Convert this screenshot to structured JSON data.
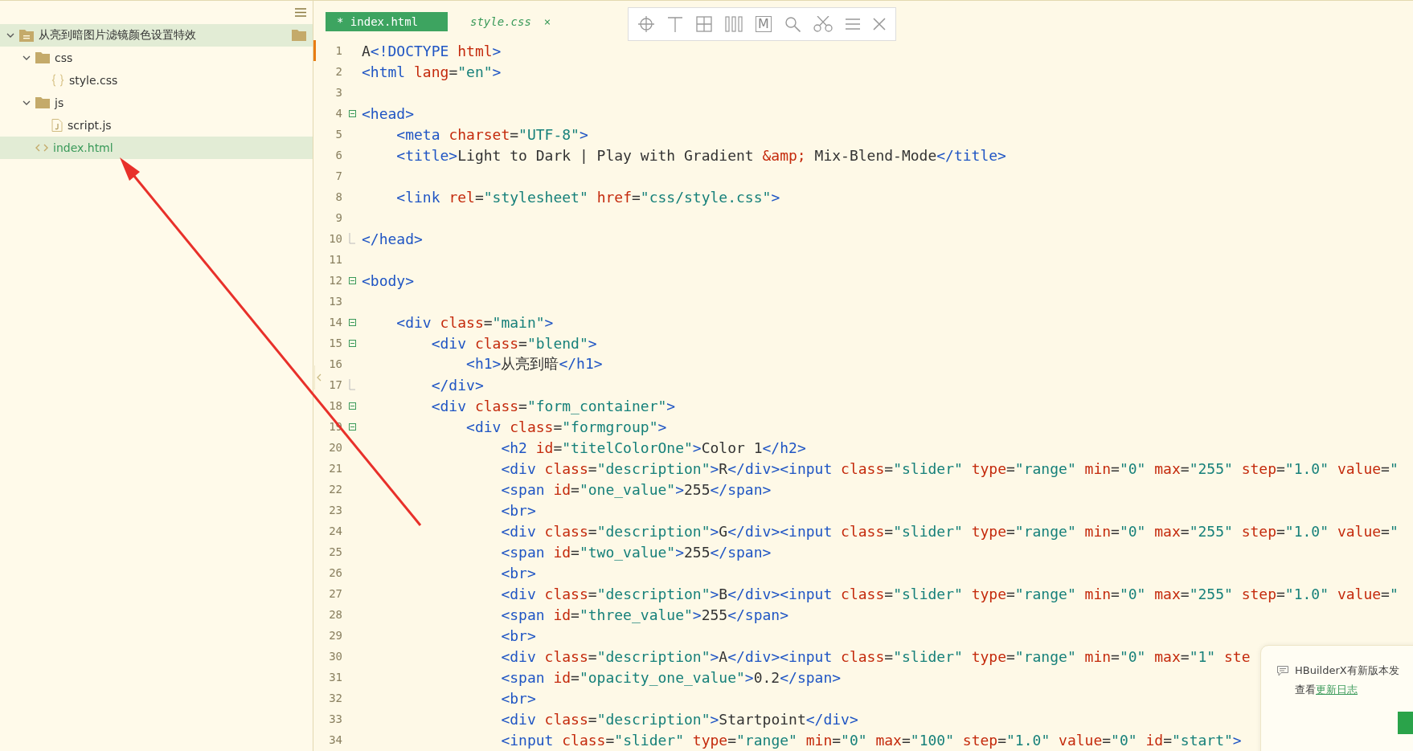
{
  "sidebar": {
    "tree": [
      {
        "name": "从亮到暗图片滤镜颜色设置特效",
        "kind": "project",
        "expanded": true,
        "selected": false,
        "children": [
          {
            "name": "css",
            "kind": "folder",
            "expanded": true,
            "selected": false,
            "children": [
              {
                "name": "style.css",
                "kind": "css",
                "selected": false
              }
            ]
          },
          {
            "name": "js",
            "kind": "folder",
            "expanded": true,
            "selected": false,
            "children": [
              {
                "name": "script.js",
                "kind": "js",
                "selected": false
              }
            ]
          },
          {
            "name": "index.html",
            "kind": "html",
            "selected": true
          }
        ]
      }
    ]
  },
  "tabs": [
    {
      "label": "* index.html",
      "selected": true
    },
    {
      "label": "style.css",
      "selected": false,
      "close": "×"
    }
  ],
  "toolbar": [
    {
      "kind": "target"
    },
    {
      "kind": "tee"
    },
    {
      "kind": "grid"
    },
    {
      "kind": "columns"
    },
    {
      "kind": "letter",
      "label": "M"
    },
    {
      "kind": "search"
    },
    {
      "kind": "scissors"
    },
    {
      "kind": "menu"
    },
    {
      "kind": "close"
    }
  ],
  "editor": {
    "lines": [
      {
        "number": "1",
        "kind": "plain",
        "tokens": [
          {
            "kind": "text",
            "text": "A"
          },
          {
            "kind": "tag",
            "text": "<!DOCTYPE"
          },
          {
            "kind": "attr",
            "text": " html"
          },
          {
            "kind": "tag",
            "text": ">"
          }
        ]
      },
      {
        "number": "2",
        "kind": "plain",
        "tokens": [
          {
            "kind": "tag",
            "text": "<html"
          },
          {
            "kind": "attr",
            "text": " lang"
          },
          {
            "kind": "text",
            "text": "="
          },
          {
            "kind": "str",
            "text": "\"en\""
          },
          {
            "kind": "tag",
            "text": ">"
          }
        ]
      },
      {
        "number": "3",
        "kind": "plain"
      },
      {
        "number": "4",
        "kind": "fold-start",
        "tokens": [
          {
            "kind": "tag",
            "text": "<head>"
          }
        ]
      },
      {
        "number": "5",
        "kind": "plain",
        "tokens": [
          {
            "kind": "tag",
            "text": "    <meta"
          },
          {
            "kind": "attr",
            "text": " charset"
          },
          {
            "kind": "text",
            "text": "="
          },
          {
            "kind": "str",
            "text": "\"UTF-8\""
          },
          {
            "kind": "tag",
            "text": ">"
          }
        ]
      },
      {
        "number": "6",
        "kind": "plain",
        "tokens": [
          {
            "kind": "tag",
            "text": "    <title>"
          },
          {
            "kind": "text",
            "text": "Light to Dark | Play with Gradient "
          },
          {
            "kind": "attr",
            "text": "&amp;"
          },
          {
            "kind": "text",
            "text": " Mix-Blend-Mode"
          },
          {
            "kind": "tag",
            "text": "</title>"
          }
        ]
      },
      {
        "number": "7",
        "kind": "plain"
      },
      {
        "number": "8",
        "kind": "plain",
        "tokens": [
          {
            "kind": "tag",
            "text": "    <link"
          },
          {
            "kind": "attr",
            "text": " rel"
          },
          {
            "kind": "text",
            "text": "="
          },
          {
            "kind": "str",
            "text": "\"stylesheet\""
          },
          {
            "kind": "attr",
            "text": " href"
          },
          {
            "kind": "text",
            "text": "="
          },
          {
            "kind": "str",
            "text": "\"css/style.css\""
          },
          {
            "kind": "tag",
            "text": ">"
          }
        ]
      },
      {
        "number": "9",
        "kind": "plain"
      },
      {
        "number": "10",
        "kind": "fold-end",
        "tokens": [
          {
            "kind": "tag",
            "text": "</head>"
          }
        ]
      },
      {
        "number": "11",
        "kind": "plain"
      },
      {
        "number": "12",
        "kind": "fold-start",
        "tokens": [
          {
            "kind": "tag",
            "text": "<body>"
          }
        ]
      },
      {
        "number": "13",
        "kind": "plain"
      },
      {
        "number": "14",
        "kind": "fold-start",
        "tokens": [
          {
            "kind": "tag",
            "text": "    <div"
          },
          {
            "kind": "attr",
            "text": " class"
          },
          {
            "kind": "text",
            "text": "="
          },
          {
            "kind": "str",
            "text": "\"main\""
          },
          {
            "kind": "tag",
            "text": ">"
          }
        ]
      },
      {
        "number": "15",
        "kind": "fold-start",
        "tokens": [
          {
            "kind": "tag",
            "text": "        <div"
          },
          {
            "kind": "attr",
            "text": " class"
          },
          {
            "kind": "text",
            "text": "="
          },
          {
            "kind": "str",
            "text": "\"blend\""
          },
          {
            "kind": "tag",
            "text": ">"
          }
        ]
      },
      {
        "number": "16",
        "kind": "plain",
        "tokens": [
          {
            "kind": "tag",
            "text": "            <h1>"
          },
          {
            "kind": "text",
            "text": "从亮到暗"
          },
          {
            "kind": "tag",
            "text": "</h1>"
          }
        ]
      },
      {
        "number": "17",
        "kind": "fold-end",
        "tokens": [
          {
            "kind": "tag",
            "text": "        </div>"
          }
        ]
      },
      {
        "number": "18",
        "kind": "fold-start",
        "tokens": [
          {
            "kind": "tag",
            "text": "        <div"
          },
          {
            "kind": "attr",
            "text": " class"
          },
          {
            "kind": "text",
            "text": "="
          },
          {
            "kind": "str",
            "text": "\"form_container\""
          },
          {
            "kind": "tag",
            "text": ">"
          }
        ]
      },
      {
        "number": "19",
        "kind": "fold-start",
        "tokens": [
          {
            "kind": "tag",
            "text": "            <div"
          },
          {
            "kind": "attr",
            "text": " class"
          },
          {
            "kind": "text",
            "text": "="
          },
          {
            "kind": "str",
            "text": "\"formgroup\""
          },
          {
            "kind": "tag",
            "text": ">"
          }
        ]
      },
      {
        "number": "20",
        "kind": "plain",
        "tokens": [
          {
            "kind": "tag",
            "text": "                <h2"
          },
          {
            "kind": "attr",
            "text": " id"
          },
          {
            "kind": "text",
            "text": "="
          },
          {
            "kind": "str",
            "text": "\"titelColorOne\""
          },
          {
            "kind": "tag",
            "text": ">"
          },
          {
            "kind": "text",
            "text": "Color 1"
          },
          {
            "kind": "tag",
            "text": "</h2>"
          }
        ]
      },
      {
        "number": "21",
        "kind": "plain",
        "tokens": [
          {
            "kind": "tag",
            "text": "                <div"
          },
          {
            "kind": "attr",
            "text": " class"
          },
          {
            "kind": "text",
            "text": "="
          },
          {
            "kind": "str",
            "text": "\"description\""
          },
          {
            "kind": "tag",
            "text": ">"
          },
          {
            "kind": "text",
            "text": "R"
          },
          {
            "kind": "tag",
            "text": "</div><input"
          },
          {
            "kind": "attr",
            "text": " class"
          },
          {
            "kind": "text",
            "text": "="
          },
          {
            "kind": "str",
            "text": "\"slider\""
          },
          {
            "kind": "attr",
            "text": " type"
          },
          {
            "kind": "text",
            "text": "="
          },
          {
            "kind": "str",
            "text": "\"range\""
          },
          {
            "kind": "attr",
            "text": " min"
          },
          {
            "kind": "text",
            "text": "="
          },
          {
            "kind": "str",
            "text": "\"0\""
          },
          {
            "kind": "attr",
            "text": " max"
          },
          {
            "kind": "text",
            "text": "="
          },
          {
            "kind": "str",
            "text": "\"255\""
          },
          {
            "kind": "attr",
            "text": " step"
          },
          {
            "kind": "text",
            "text": "="
          },
          {
            "kind": "str",
            "text": "\"1.0\""
          },
          {
            "kind": "attr",
            "text": " value"
          },
          {
            "kind": "text",
            "text": "="
          },
          {
            "kind": "str",
            "text": "\""
          }
        ]
      },
      {
        "number": "22",
        "kind": "plain",
        "tokens": [
          {
            "kind": "tag",
            "text": "                <span"
          },
          {
            "kind": "attr",
            "text": " id"
          },
          {
            "kind": "text",
            "text": "="
          },
          {
            "kind": "str",
            "text": "\"one_value\""
          },
          {
            "kind": "tag",
            "text": ">"
          },
          {
            "kind": "text",
            "text": "255"
          },
          {
            "kind": "tag",
            "text": "</span>"
          }
        ]
      },
      {
        "number": "23",
        "kind": "plain",
        "tokens": [
          {
            "kind": "tag",
            "text": "                <br>"
          }
        ]
      },
      {
        "number": "24",
        "kind": "plain",
        "tokens": [
          {
            "kind": "tag",
            "text": "                <div"
          },
          {
            "kind": "attr",
            "text": " class"
          },
          {
            "kind": "text",
            "text": "="
          },
          {
            "kind": "str",
            "text": "\"description\""
          },
          {
            "kind": "tag",
            "text": ">"
          },
          {
            "kind": "text",
            "text": "G"
          },
          {
            "kind": "tag",
            "text": "</div><input"
          },
          {
            "kind": "attr",
            "text": " class"
          },
          {
            "kind": "text",
            "text": "="
          },
          {
            "kind": "str",
            "text": "\"slider\""
          },
          {
            "kind": "attr",
            "text": " type"
          },
          {
            "kind": "text",
            "text": "="
          },
          {
            "kind": "str",
            "text": "\"range\""
          },
          {
            "kind": "attr",
            "text": " min"
          },
          {
            "kind": "text",
            "text": "="
          },
          {
            "kind": "str",
            "text": "\"0\""
          },
          {
            "kind": "attr",
            "text": " max"
          },
          {
            "kind": "text",
            "text": "="
          },
          {
            "kind": "str",
            "text": "\"255\""
          },
          {
            "kind": "attr",
            "text": " step"
          },
          {
            "kind": "text",
            "text": "="
          },
          {
            "kind": "str",
            "text": "\"1.0\""
          },
          {
            "kind": "attr",
            "text": " value"
          },
          {
            "kind": "text",
            "text": "="
          },
          {
            "kind": "str",
            "text": "\""
          }
        ]
      },
      {
        "number": "25",
        "kind": "plain",
        "tokens": [
          {
            "kind": "tag",
            "text": "                <span"
          },
          {
            "kind": "attr",
            "text": " id"
          },
          {
            "kind": "text",
            "text": "="
          },
          {
            "kind": "str",
            "text": "\"two_value\""
          },
          {
            "kind": "tag",
            "text": ">"
          },
          {
            "kind": "text",
            "text": "255"
          },
          {
            "kind": "tag",
            "text": "</span>"
          }
        ]
      },
      {
        "number": "26",
        "kind": "plain",
        "tokens": [
          {
            "kind": "tag",
            "text": "                <br>"
          }
        ]
      },
      {
        "number": "27",
        "kind": "plain",
        "tokens": [
          {
            "kind": "tag",
            "text": "                <div"
          },
          {
            "kind": "attr",
            "text": " class"
          },
          {
            "kind": "text",
            "text": "="
          },
          {
            "kind": "str",
            "text": "\"description\""
          },
          {
            "kind": "tag",
            "text": ">"
          },
          {
            "kind": "text",
            "text": "B"
          },
          {
            "kind": "tag",
            "text": "</div><input"
          },
          {
            "kind": "attr",
            "text": " class"
          },
          {
            "kind": "text",
            "text": "="
          },
          {
            "kind": "str",
            "text": "\"slider\""
          },
          {
            "kind": "attr",
            "text": " type"
          },
          {
            "kind": "text",
            "text": "="
          },
          {
            "kind": "str",
            "text": "\"range\""
          },
          {
            "kind": "attr",
            "text": " min"
          },
          {
            "kind": "text",
            "text": "="
          },
          {
            "kind": "str",
            "text": "\"0\""
          },
          {
            "kind": "attr",
            "text": " max"
          },
          {
            "kind": "text",
            "text": "="
          },
          {
            "kind": "str",
            "text": "\"255\""
          },
          {
            "kind": "attr",
            "text": " step"
          },
          {
            "kind": "text",
            "text": "="
          },
          {
            "kind": "str",
            "text": "\"1.0\""
          },
          {
            "kind": "attr",
            "text": " value"
          },
          {
            "kind": "text",
            "text": "="
          },
          {
            "kind": "str",
            "text": "\""
          }
        ]
      },
      {
        "number": "28",
        "kind": "plain",
        "tokens": [
          {
            "kind": "tag",
            "text": "                <span"
          },
          {
            "kind": "attr",
            "text": " id"
          },
          {
            "kind": "text",
            "text": "="
          },
          {
            "kind": "str",
            "text": "\"three_value\""
          },
          {
            "kind": "tag",
            "text": ">"
          },
          {
            "kind": "text",
            "text": "255"
          },
          {
            "kind": "tag",
            "text": "</span>"
          }
        ]
      },
      {
        "number": "29",
        "kind": "plain",
        "tokens": [
          {
            "kind": "tag",
            "text": "                <br>"
          }
        ]
      },
      {
        "number": "30",
        "kind": "plain",
        "tokens": [
          {
            "kind": "tag",
            "text": "                <div"
          },
          {
            "kind": "attr",
            "text": " class"
          },
          {
            "kind": "text",
            "text": "="
          },
          {
            "kind": "str",
            "text": "\"description\""
          },
          {
            "kind": "tag",
            "text": ">"
          },
          {
            "kind": "text",
            "text": "A"
          },
          {
            "kind": "tag",
            "text": "</div><input"
          },
          {
            "kind": "attr",
            "text": " class"
          },
          {
            "kind": "text",
            "text": "="
          },
          {
            "kind": "str",
            "text": "\"slider\""
          },
          {
            "kind": "attr",
            "text": " type"
          },
          {
            "kind": "text",
            "text": "="
          },
          {
            "kind": "str",
            "text": "\"range\""
          },
          {
            "kind": "attr",
            "text": " min"
          },
          {
            "kind": "text",
            "text": "="
          },
          {
            "kind": "str",
            "text": "\"0\""
          },
          {
            "kind": "attr",
            "text": " max"
          },
          {
            "kind": "text",
            "text": "="
          },
          {
            "kind": "str",
            "text": "\"1\""
          },
          {
            "kind": "attr",
            "text": " ste"
          }
        ]
      },
      {
        "number": "31",
        "kind": "plain",
        "tokens": [
          {
            "kind": "tag",
            "text": "                <span"
          },
          {
            "kind": "attr",
            "text": " id"
          },
          {
            "kind": "text",
            "text": "="
          },
          {
            "kind": "str",
            "text": "\"opacity_one_value\""
          },
          {
            "kind": "tag",
            "text": ">"
          },
          {
            "kind": "text",
            "text": "0.2"
          },
          {
            "kind": "tag",
            "text": "</span>"
          }
        ]
      },
      {
        "number": "32",
        "kind": "plain",
        "tokens": [
          {
            "kind": "tag",
            "text": "                <br>"
          }
        ]
      },
      {
        "number": "33",
        "kind": "plain",
        "tokens": [
          {
            "kind": "tag",
            "text": "                <div"
          },
          {
            "kind": "attr",
            "text": " class"
          },
          {
            "kind": "text",
            "text": "="
          },
          {
            "kind": "str",
            "text": "\"description\""
          },
          {
            "kind": "tag",
            "text": ">"
          },
          {
            "kind": "text",
            "text": "Startpoint"
          },
          {
            "kind": "tag",
            "text": "</div>"
          }
        ]
      },
      {
        "number": "34",
        "kind": "plain",
        "tokens": [
          {
            "kind": "tag",
            "text": "                <input"
          },
          {
            "kind": "attr",
            "text": " class"
          },
          {
            "kind": "text",
            "text": "="
          },
          {
            "kind": "str",
            "text": "\"slider\""
          },
          {
            "kind": "attr",
            "text": " type"
          },
          {
            "kind": "text",
            "text": "="
          },
          {
            "kind": "str",
            "text": "\"range\""
          },
          {
            "kind": "attr",
            "text": " min"
          },
          {
            "kind": "text",
            "text": "="
          },
          {
            "kind": "str",
            "text": "\"0\""
          },
          {
            "kind": "attr",
            "text": " max"
          },
          {
            "kind": "text",
            "text": "="
          },
          {
            "kind": "str",
            "text": "\"100\""
          },
          {
            "kind": "attr",
            "text": " step"
          },
          {
            "kind": "text",
            "text": "="
          },
          {
            "kind": "str",
            "text": "\"1.0\""
          },
          {
            "kind": "attr",
            "text": " value"
          },
          {
            "kind": "text",
            "text": "="
          },
          {
            "kind": "str",
            "text": "\"0\""
          },
          {
            "kind": "attr",
            "text": " id"
          },
          {
            "kind": "text",
            "text": "="
          },
          {
            "kind": "str",
            "text": "\"start\""
          },
          {
            "kind": "tag",
            "text": ">"
          }
        ]
      }
    ]
  },
  "notification": {
    "message": "HBuilderX有新版本发",
    "prefix": "查看",
    "link": "更新日志"
  }
}
